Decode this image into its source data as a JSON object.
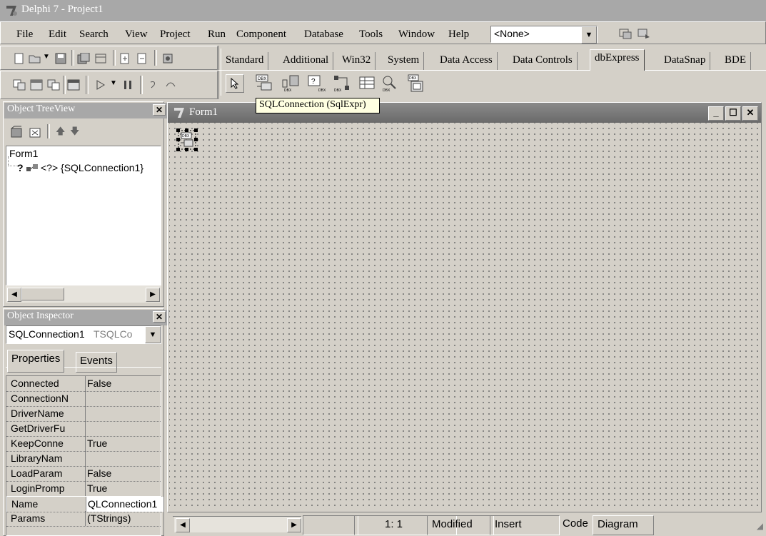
{
  "window": {
    "title": "Delphi 7 - Project1"
  },
  "menu": [
    "File",
    "Edit",
    "Search",
    "View",
    "Project",
    "Run",
    "Component",
    "Database",
    "Tools",
    "Window",
    "Help"
  ],
  "config_combo": {
    "value": "<None>"
  },
  "palette": {
    "tabs": [
      "Standard",
      "Additional",
      "Win32",
      "System",
      "Data Access",
      "Data Controls",
      "dbExpress",
      "DataSnap",
      "BDE"
    ],
    "active": "dbExpress"
  },
  "tooltip": "SQLConnection (SqlExpr)",
  "tree_view": {
    "title": "Object TreeView",
    "root": "Form1",
    "child": "<?> {SQLConnection1}"
  },
  "inspector": {
    "title": "Object Inspector",
    "selected_name": "SQLConnection1",
    "selected_type": "TSQLCo",
    "tabs": [
      "Properties",
      "Events"
    ],
    "properties": [
      {
        "name": "Connected",
        "value": "False"
      },
      {
        "name": "ConnectionN",
        "value": ""
      },
      {
        "name": "DriverName",
        "value": ""
      },
      {
        "name": "GetDriverFu",
        "value": ""
      },
      {
        "name": "KeepConne",
        "value": "True"
      },
      {
        "name": "LibraryNam",
        "value": ""
      },
      {
        "name": "LoadParam",
        "value": "False"
      },
      {
        "name": "LoginPromp",
        "value": "True"
      },
      {
        "name": "Name",
        "value": "QLConnection1"
      },
      {
        "name": "Params",
        "value": "(TStrings)"
      }
    ]
  },
  "form": {
    "title": "Form1"
  },
  "status": {
    "position": "1:  1",
    "modified": "Modified",
    "mode": "Insert",
    "tab_code": "Code",
    "tab_diagram": "Diagram"
  },
  "colors": {
    "titlebar": "#a8a8a8",
    "face": "#d4d0c8",
    "tooltip": "#ffffe1"
  }
}
